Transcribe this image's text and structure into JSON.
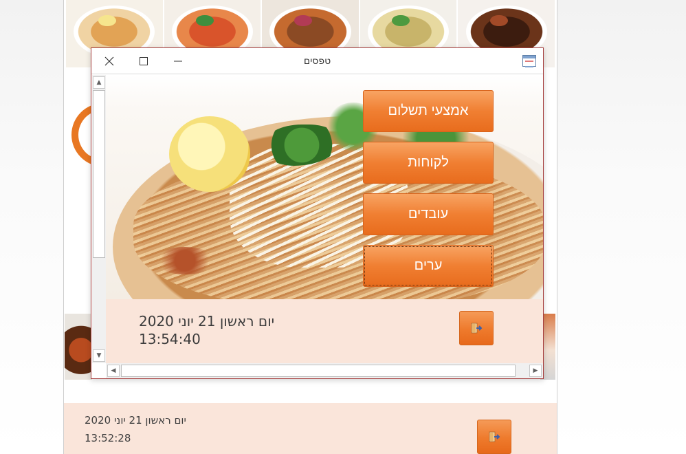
{
  "background": {
    "footer": {
      "date": "יום ראשון 21 יוני 2020",
      "time": "13:52:28"
    },
    "exit_icon": "exit-door-icon"
  },
  "window": {
    "title": "טפסים",
    "controls": {
      "close_icon": "close-icon",
      "maximize_icon": "maximize-icon",
      "minimize_icon": "minimize-icon",
      "app_icon": "form-app-icon"
    },
    "menu": [
      {
        "label": "אמצעי תשלום"
      },
      {
        "label": "לקוחות"
      },
      {
        "label": "עובדים"
      },
      {
        "label": "ערים"
      }
    ],
    "footer": {
      "date": "יום ראשון 21 יוני 2020",
      "time": "13:54:40"
    },
    "exit_icon": "exit-door-icon"
  },
  "colors": {
    "accent_orange": "#ee7a2c",
    "footer_bg": "#fae5da",
    "window_border": "#a63d3d"
  }
}
